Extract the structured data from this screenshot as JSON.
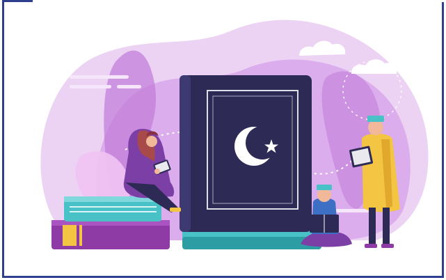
{
  "illustration": {
    "icon": "crescent-star-icon",
    "colors": {
      "frame": "#2e3f8f",
      "background_blob": "#e7c9f0",
      "background_blob_deep": "#c98be0",
      "book_cover": "#2d2b56",
      "book_pages": "#48c2c7",
      "accent_purple": "#7b3fa6",
      "accent_yellow": "#f4c542",
      "cream": "#fff4d6"
    }
  }
}
